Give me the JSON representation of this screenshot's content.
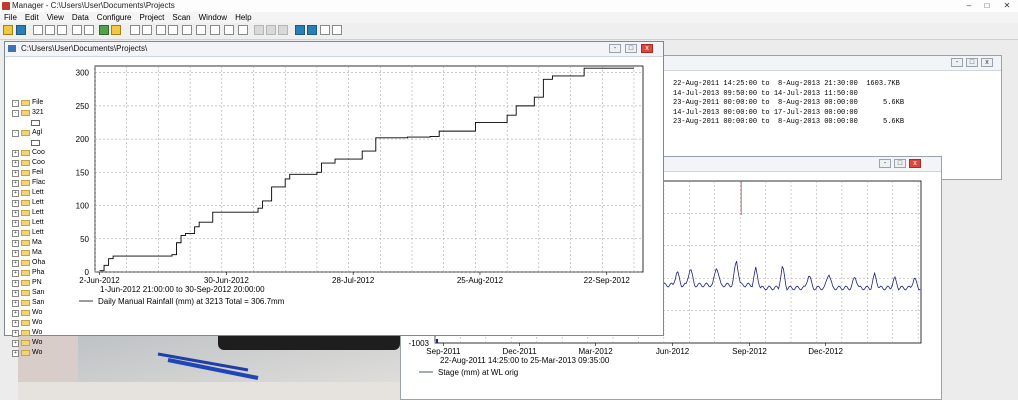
{
  "app": {
    "title": "Manager - C:\\Users\\User\\Documents\\Projects",
    "controls": [
      "–",
      "□",
      "✕"
    ]
  },
  "menu": [
    "File",
    "Edit",
    "View",
    "Data",
    "Configure",
    "Project",
    "Scan",
    "Window",
    "Help"
  ],
  "toolbar_icons": [
    "open-icon",
    "save-icon",
    "print-icon",
    "doc-icon",
    "doc-icon",
    "doc-icon",
    "doc-icon",
    "zoom-icon",
    "zoom-icon",
    "check-icon",
    "clock-icon",
    "window-icon",
    "window-icon",
    "window-icon",
    "window-icon",
    "window-icon",
    "window-icon",
    "window-icon",
    "window-icon",
    "window-icon",
    "chart-icon",
    "chart-icon",
    "chart-icon",
    "export-icon",
    "hr-icon",
    "help-icon",
    "whatsthis-icon"
  ],
  "tree": {
    "items": [
      {
        "label": "File",
        "expand": "-",
        "kind": "folder"
      },
      {
        "label": "321",
        "expand": "-",
        "kind": "folder"
      },
      {
        "label": "",
        "expand": "",
        "kind": "chart"
      },
      {
        "label": "Agl",
        "expand": "-",
        "kind": "folder"
      },
      {
        "label": "",
        "expand": "",
        "kind": "chart"
      },
      {
        "label": "Coo",
        "expand": "+",
        "kind": "folder"
      },
      {
        "label": "Coo",
        "expand": "+",
        "kind": "folder"
      },
      {
        "label": "Feil",
        "expand": "+",
        "kind": "folder"
      },
      {
        "label": "Flac",
        "expand": "+",
        "kind": "folder"
      },
      {
        "label": "Lett",
        "expand": "+",
        "kind": "folder"
      },
      {
        "label": "Lett",
        "expand": "+",
        "kind": "folder"
      },
      {
        "label": "Lett",
        "expand": "+",
        "kind": "folder"
      },
      {
        "label": "Lett",
        "expand": "+",
        "kind": "folder"
      },
      {
        "label": "Lett",
        "expand": "+",
        "kind": "folder"
      },
      {
        "label": "Ma",
        "expand": "+",
        "kind": "folder"
      },
      {
        "label": "Ma",
        "expand": "+",
        "kind": "folder"
      },
      {
        "label": "Oha",
        "expand": "+",
        "kind": "folder"
      },
      {
        "label": "Pha",
        "expand": "+",
        "kind": "folder"
      },
      {
        "label": "PN",
        "expand": "+",
        "kind": "folder"
      },
      {
        "label": "San",
        "expand": "+",
        "kind": "folder"
      },
      {
        "label": "San",
        "expand": "+",
        "kind": "folder"
      },
      {
        "label": "Wo",
        "expand": "+",
        "kind": "folder"
      },
      {
        "label": "Wo",
        "expand": "+",
        "kind": "folder"
      },
      {
        "label": "Wo",
        "expand": "+",
        "kind": "folder"
      },
      {
        "label": "Wo",
        "expand": "+",
        "kind": "folder"
      },
      {
        "label": "Wo",
        "expand": "+",
        "kind": "folder"
      }
    ]
  },
  "info_window": {
    "rows": [
      "22-Aug-2011 14:25:00 to  8-Aug-2013 21:30:00  1603.7KB",
      "14-Jul-2013 09:50:00 to 14-Jul-2013 11:50:00",
      "23-Aug-2011 00:00:00 to  8-Aug-2013 00:00:00      5.6KB",
      "14-Jul-2013 00:00:00 to 17-Jul-2013 00:00:00",
      "23-Aug-2011 00:00:00 to  8-Aug-2013 00:00:00      5.6KB"
    ]
  },
  "rain_window": {
    "title": "C:\\Users\\User\\Documents\\Projects\\"
  },
  "stage_window": {
    "title": ""
  },
  "chart_data": [
    {
      "type": "line",
      "title": "",
      "subtitle": "1-Jun-2012 21:00:00 to 30-Sep-2012 20:00:00",
      "legend": "Daily Manual Rainfall (mm) at 3213   Total = 306.7mm",
      "legend_position": "bottom-left",
      "grid": true,
      "xlim": [
        "2012-06-01",
        "2012-09-30"
      ],
      "ylim": [
        0,
        310
      ],
      "xticks": [
        "2-Jun-2012",
        "30-Jun-2012",
        "28-Jul-2012",
        "25-Aug-2012",
        "22-Sep-2012"
      ],
      "yticks": [
        0,
        50,
        100,
        150,
        200,
        250,
        300
      ],
      "series": [
        {
          "name": "Daily Manual Rainfall (mm) at 3213",
          "color": "#000000",
          "x": [
            "2012-06-02",
            "2012-06-03",
            "2012-06-04",
            "2012-06-05",
            "2012-06-18",
            "2012-06-19",
            "2012-06-20",
            "2012-06-21",
            "2012-06-23",
            "2012-06-24",
            "2012-06-27",
            "2012-07-07",
            "2012-07-08",
            "2012-07-10",
            "2012-07-13",
            "2012-07-14",
            "2012-07-20",
            "2012-07-21",
            "2012-07-24",
            "2012-07-30",
            "2012-08-02",
            "2012-08-09",
            "2012-08-14",
            "2012-08-16",
            "2012-08-24",
            "2012-08-31",
            "2012-09-02",
            "2012-09-06",
            "2012-09-08",
            "2012-09-10",
            "2012-09-17",
            "2012-09-28"
          ],
          "y": [
            2,
            10,
            20,
            24,
            26,
            44,
            55,
            58,
            68,
            75,
            90,
            96,
            107,
            128,
            140,
            147,
            150,
            164,
            170,
            182,
            202,
            203,
            204,
            212,
            225,
            236,
            250,
            263,
            290,
            295,
            306.7,
            306.7
          ]
        }
      ]
    },
    {
      "type": "line",
      "title": "",
      "subtitle": "22-Aug-2011 14:25:00 to 25-Mar-2013 09:35:00",
      "legend": "Stage (mm) at WL orig",
      "legend_position": "bottom-left",
      "grid": true,
      "xlim": [
        "2011-08-22",
        "2013-03-25"
      ],
      "xticks": [
        "Sep-2011",
        "Dec-2011",
        "Mar-2012",
        "Jun-2012",
        "Sep-2012",
        "Dec-2012"
      ],
      "yticks": [
        "-1003"
      ],
      "series": [
        {
          "name": "Stage (mm) at WL orig",
          "color": "#1a237e"
        }
      ]
    }
  ]
}
